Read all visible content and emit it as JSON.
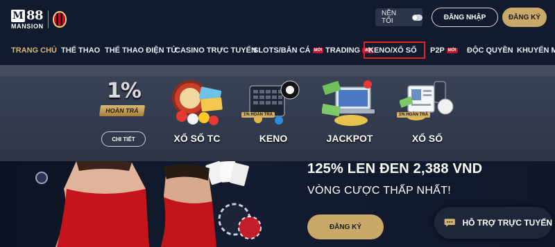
{
  "header": {
    "logo_text": "M88",
    "logo_m": "M",
    "logo_num": "88",
    "logo_sub": "MANSION",
    "dark_mode_label": "NỀN TỐI",
    "login_label": "ĐĂNG NHẬP",
    "register_label": "ĐĂNG KÝ"
  },
  "nav": {
    "items": [
      {
        "label": "TRANG CHỦ",
        "active": true
      },
      {
        "label": "THỂ THAO"
      },
      {
        "label": "THỂ THAO ĐIỆN TỬ"
      },
      {
        "label": "CASINO TRỰC TUYẾN"
      },
      {
        "label": "SLOTS/BẮN CÁ",
        "badge": "MỚI"
      },
      {
        "label": "TRADING",
        "badge": "MỚI"
      },
      {
        "label": "KENO/XỔ SỐ",
        "highlighted": true
      },
      {
        "label": "P2P",
        "badge": "MỚI"
      },
      {
        "label": "ĐỘC QUYỀN"
      },
      {
        "label": "KHUYẾN MÃ"
      }
    ]
  },
  "dropdown": {
    "rebate_percent": "1%",
    "rebate_label": "HOÀN TRẢ",
    "detail_button": "CHI TIẾT",
    "games": [
      {
        "title": "XỔ SỐ TC",
        "icon": "lottery-balls-icon"
      },
      {
        "title": "KENO",
        "icon": "keno-board-icon",
        "mini_rebate": "1% HOÀN TRẢ"
      },
      {
        "title": "JACKPOT",
        "icon": "jackpot-laptop-icon"
      },
      {
        "title": "XỔ SỐ",
        "icon": "lottery-ticket-icon",
        "mini_rebate": "1% HOÀN TRẢ"
      }
    ]
  },
  "hero": {
    "title": "125% LEN ĐEN 2,388 VND",
    "subtitle": "VÒNG CƯỢC THẤP NHẤT!",
    "register_button": "ĐĂNG KÝ"
  },
  "support": {
    "label": "HỖ TRỢ TRỰC TUYẾN",
    "icon": "chat-bubble-icon"
  },
  "colors": {
    "accent_gold": "#c9a96a",
    "active_nav": "#d7b676",
    "new_badge": "#c8102e",
    "highlight_border": "#e02424"
  }
}
